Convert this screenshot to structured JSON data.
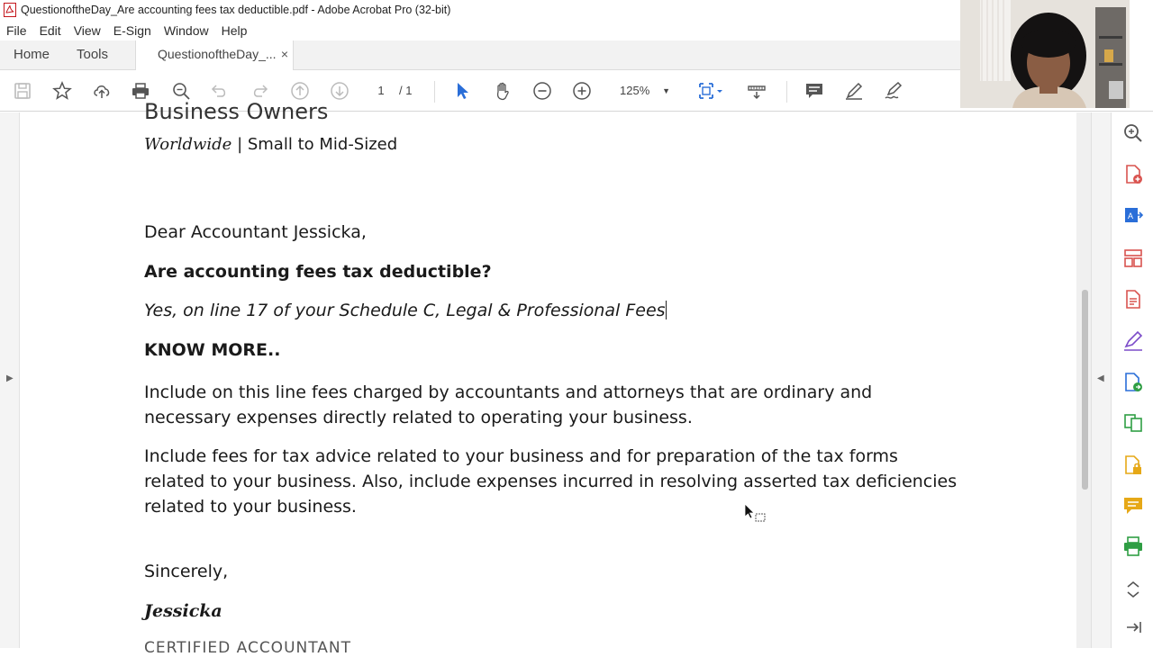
{
  "window": {
    "title": "QuestionoftheDay_Are accounting fees tax deductible.pdf - Adobe Acrobat Pro (32-bit)"
  },
  "menu": [
    "File",
    "Edit",
    "View",
    "E-Sign",
    "Window",
    "Help"
  ],
  "tabs": {
    "home": "Home",
    "tools": "Tools",
    "document": "QuestionoftheDay_...",
    "close_glyph": "×"
  },
  "toolbar": {
    "page_current": "1",
    "page_total": "/ 1",
    "zoom": "125%",
    "icons": [
      "save-icon",
      "bookmark-star-icon",
      "upload-cloud-icon",
      "print-icon",
      "search-zoom-icon",
      "undo-icon",
      "redo-icon",
      "prev-page-icon",
      "next-page-icon",
      "select-cursor-icon",
      "hand-icon",
      "zoom-out-icon",
      "zoom-in-icon",
      "page-fit-icon",
      "scroll-mode-icon",
      "comment-icon",
      "highlight-pen-icon",
      "sign-icon"
    ]
  },
  "document": {
    "heading_partial": "Business Owners",
    "tagline_worldwide": "Worldwide",
    "tagline_rest": " | Small to Mid-Sized",
    "greeting": "Dear Accountant Jessicka,",
    "question": "Are accounting fees tax deductible?",
    "answer": "Yes, on line 17 of your Schedule C, Legal & Professional Fees",
    "know_more": "KNOW MORE..",
    "paragraph1": "Include on this line fees charged by accountants and attorneys that are ordinary and necessary expenses directly related to operating your business.",
    "paragraph2": "Include fees for tax advice related to your business and for preparation of the tax forms related to your business. Also, include expenses incurred in resolving asserted tax deficiencies related to your business.",
    "closing": "Sincerely,",
    "signature": "Jessicka",
    "title_partial": "CERTIFIED ACCOUNTANT"
  },
  "right_panel_tools": [
    "search-tool-icon",
    "create-pdf-icon",
    "export-pdf-icon",
    "organize-pages-icon",
    "edit-pdf-icon",
    "fill-sign-icon",
    "request-signature-icon",
    "combine-files-icon",
    "protect-icon",
    "comment-tool-icon",
    "print-production-icon",
    "more-tools-chevron-icon",
    "collapse-panel-icon"
  ],
  "colors": {
    "accent_blue": "#2a6ed8",
    "create_red": "#d9534f",
    "tool_purple": "#7b4bc9",
    "tool_green": "#2f9e44",
    "tool_yellow": "#e6a817"
  }
}
